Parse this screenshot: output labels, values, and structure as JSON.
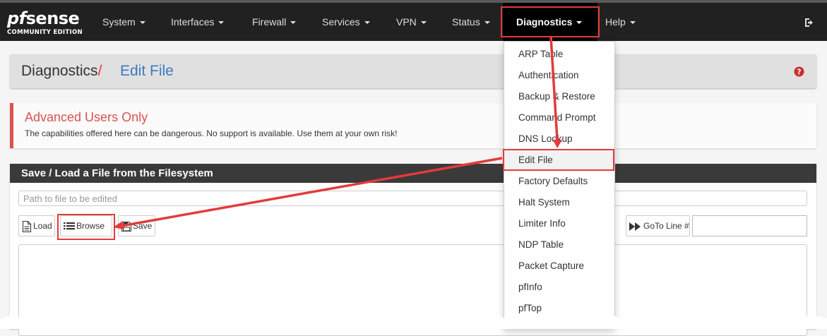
{
  "brand": {
    "logo_prefix": "pf",
    "logo_suffix": "sense",
    "edition": "COMMUNITY EDITION"
  },
  "nav": {
    "items": [
      {
        "label": "System"
      },
      {
        "label": "Interfaces"
      },
      {
        "label": "Firewall"
      },
      {
        "label": "Services"
      },
      {
        "label": "VPN"
      },
      {
        "label": "Status"
      },
      {
        "label": "Diagnostics",
        "active": true
      },
      {
        "label": "Help"
      }
    ],
    "logout_icon": "sign-out-icon"
  },
  "header": {
    "section": "Diagnostics",
    "separator": "/",
    "page": "Edit File",
    "help_icon": "question-circle-icon"
  },
  "alert": {
    "title": "Advanced Users Only",
    "text": "The capabilities offered here can be dangerous. No support is available. Use them at your own risk!"
  },
  "panel": {
    "title": "Save / Load a File from the Filesystem",
    "path_placeholder": "Path to file to be edited",
    "buttons": {
      "load": "Load",
      "browse": "Browse",
      "save": "Save",
      "goto_line": "GoTo Line #"
    }
  },
  "dropdown": {
    "items": [
      "ARP Table",
      "Authentication",
      "Backup & Restore",
      "Command Prompt",
      "DNS Lookup",
      "Edit File",
      "Factory Defaults",
      "Halt System",
      "Limiter Info",
      "NDP Table",
      "Packet Capture",
      "pfInfo",
      "pfTop"
    ],
    "active": "Edit File"
  },
  "colors": {
    "navbar": "#212121",
    "highlight": "#e23b3b",
    "link_blue": "#3b7bbf",
    "alert_red": "#d9534f"
  }
}
